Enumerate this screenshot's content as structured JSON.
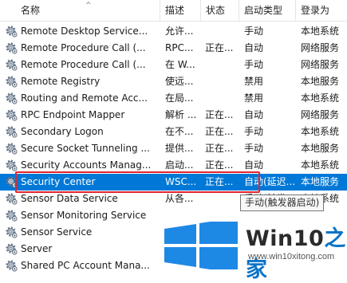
{
  "columns": {
    "name": "名称",
    "description": "描述",
    "status": "状态",
    "startup_type": "启动类型",
    "logon_as": "登录为"
  },
  "services": [
    {
      "name": "Remote Desktop Service...",
      "description": "允许...",
      "status": "",
      "startup_type": "手动",
      "logon_as": "本地系统"
    },
    {
      "name": "Remote Procedure Call (...",
      "description": "RPC...",
      "status": "正在...",
      "startup_type": "自动",
      "logon_as": "网络服务"
    },
    {
      "name": "Remote Procedure Call (...",
      "description": "在 W...",
      "status": "",
      "startup_type": "手动",
      "logon_as": "网络服务"
    },
    {
      "name": "Remote Registry",
      "description": "使远...",
      "status": "",
      "startup_type": "禁用",
      "logon_as": "本地服务"
    },
    {
      "name": "Routing and Remote Acc...",
      "description": "在局...",
      "status": "",
      "startup_type": "禁用",
      "logon_as": "本地系统"
    },
    {
      "name": "RPC Endpoint Mapper",
      "description": "解析 ...",
      "status": "正在...",
      "startup_type": "自动",
      "logon_as": "网络服务"
    },
    {
      "name": "Secondary Logon",
      "description": "在不...",
      "status": "正在...",
      "startup_type": "手动",
      "logon_as": "本地系统"
    },
    {
      "name": "Secure Socket Tunneling ...",
      "description": "提供...",
      "status": "正在...",
      "startup_type": "手动",
      "logon_as": "本地服务"
    },
    {
      "name": "Security Accounts Manag...",
      "description": "启动...",
      "status": "正在...",
      "startup_type": "自动",
      "logon_as": "本地系统"
    },
    {
      "name": "Security Center",
      "description": "WSC...",
      "status": "正在...",
      "startup_type": "自动(延迟...",
      "logon_as": "本地服务"
    },
    {
      "name": "Sensor Data Service",
      "description": "从各...",
      "status": "",
      "startup_type": "手动(触发...",
      "logon_as": "本地系统"
    },
    {
      "name": "Sensor Monitoring Service",
      "description": "",
      "status": "",
      "startup_type": "",
      "logon_as": ""
    },
    {
      "name": "Sensor Service",
      "description": "",
      "status": "",
      "startup_type": "",
      "logon_as": ""
    },
    {
      "name": "Server",
      "description": "",
      "status": "",
      "startup_type": "",
      "logon_as": ""
    },
    {
      "name": "Shared PC Account Mana...",
      "description": "",
      "status": "",
      "startup_type": "",
      "logon_as": ""
    }
  ],
  "selected_service": "Security Center",
  "tooltip": "手动(触发器启动)",
  "watermark": {
    "brand_prefix": "Win10",
    "brand_suffix": "之家",
    "url": "www.win10xitong.com"
  },
  "colors": {
    "selection": "#0078d7",
    "highlight_box": "#e3242b",
    "watermark_logo": "#1e88e5"
  },
  "icons": {
    "service": "gear-icon",
    "sort_indicator": "sort-ascending-icon",
    "watermark_logo": "windows-logo-icon"
  }
}
